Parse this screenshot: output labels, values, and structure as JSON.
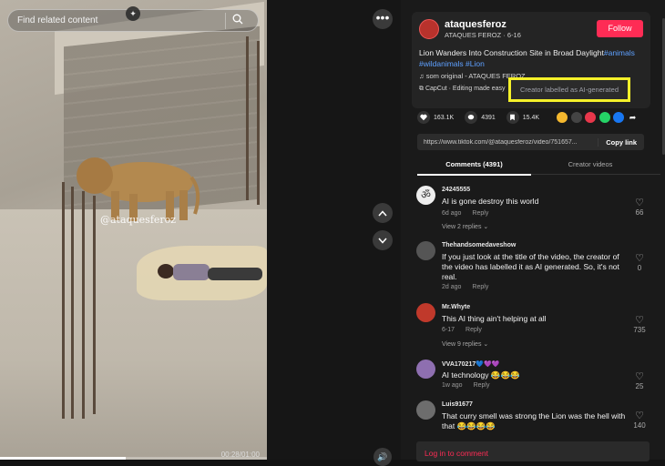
{
  "video": {
    "search_placeholder": "Find related content",
    "watermark": "@ataquesferoz",
    "timecode": "00:28/01:00",
    "progress_fraction": 0.47
  },
  "post": {
    "author": "ataquesferoz",
    "author_sub": "ATAQUES FEROZ · 6-16",
    "follow_label": "Follow",
    "caption_text": "Lion Wanders Into Construction Site in Broad Daylight",
    "caption_tags": [
      "#animals",
      "#wildanimals",
      "#Lion"
    ],
    "music": "som original - ATAQUES FEROZ",
    "capcut": "CapCut · Editing made easy",
    "ai_label": "Creator labelled as AI-generated",
    "likes": "163.1K",
    "comments_count": "4391",
    "saves": "15.4K",
    "link": "https://www.tiktok.com/@ataquesferoz/video/751657...",
    "copy_label": "Copy link"
  },
  "tabs": {
    "comments": "Comments (4391)",
    "creator_videos": "Creator videos"
  },
  "comments": [
    {
      "user": "24245555",
      "text": "AI is gone destroy this world",
      "time": "6d ago",
      "reply": "Reply",
      "likes": "66",
      "views": "View 2 replies",
      "avatar_color": "#eeeeee"
    },
    {
      "user": "Thehandsomedaveshow",
      "text": "If you just look at the title of the video, the creator of the video has labelled it as AI generated. So, it's not real.",
      "time": "2d ago",
      "reply": "Reply",
      "likes": "0",
      "views": "",
      "avatar_color": "#555555"
    },
    {
      "user": "Mr.Whyte",
      "text": "This AI thing ain't helping at all",
      "time": "6-17",
      "reply": "Reply",
      "likes": "735",
      "views": "View 9 replies",
      "avatar_color": "#c0392b"
    },
    {
      "user": "VVA170217💙💜💜",
      "text": "AI technology 😂😂😂",
      "time": "1w ago",
      "reply": "Reply",
      "likes": "25",
      "views": "",
      "avatar_color": "#8e6fb0"
    },
    {
      "user": "Luis91677",
      "text": "That curry smell was strong the Lion was the hell with that 😂😂😂😂",
      "time": "",
      "reply": "",
      "likes": "140",
      "views": "",
      "avatar_color": "#6d6d6d"
    }
  ],
  "login_label": "Log in to comment",
  "colors": {
    "accent": "#fe2c55",
    "hashtag": "#5ea0ff",
    "highlight": "#f5f12a"
  }
}
